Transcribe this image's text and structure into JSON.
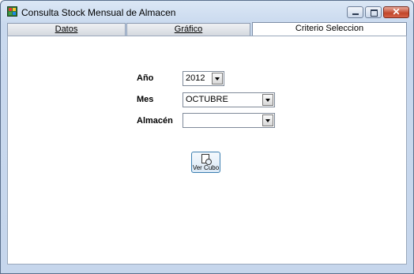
{
  "window": {
    "title": "Consulta Stock Mensual de Almacen",
    "close_glyph": "✕"
  },
  "tabs": [
    {
      "label": "Datos"
    },
    {
      "label": "Gráfico"
    },
    {
      "label": "Criterio Seleccion"
    }
  ],
  "form": {
    "anio_label": "Año",
    "anio_value": "2012",
    "mes_label": "Mes",
    "mes_value": "OCTUBRE",
    "almacen_label": "Almacén",
    "almacen_value": ""
  },
  "buttons": {
    "ver_cubo": "Ver Cubo"
  },
  "icons": {
    "app": "grid-app-icon",
    "ver_cubo": "document-magnifier-icon"
  },
  "colors": {
    "title_gradient_top": "#dbe7f5",
    "close_button": "#c2462a",
    "button_border": "#3c7fb1"
  }
}
